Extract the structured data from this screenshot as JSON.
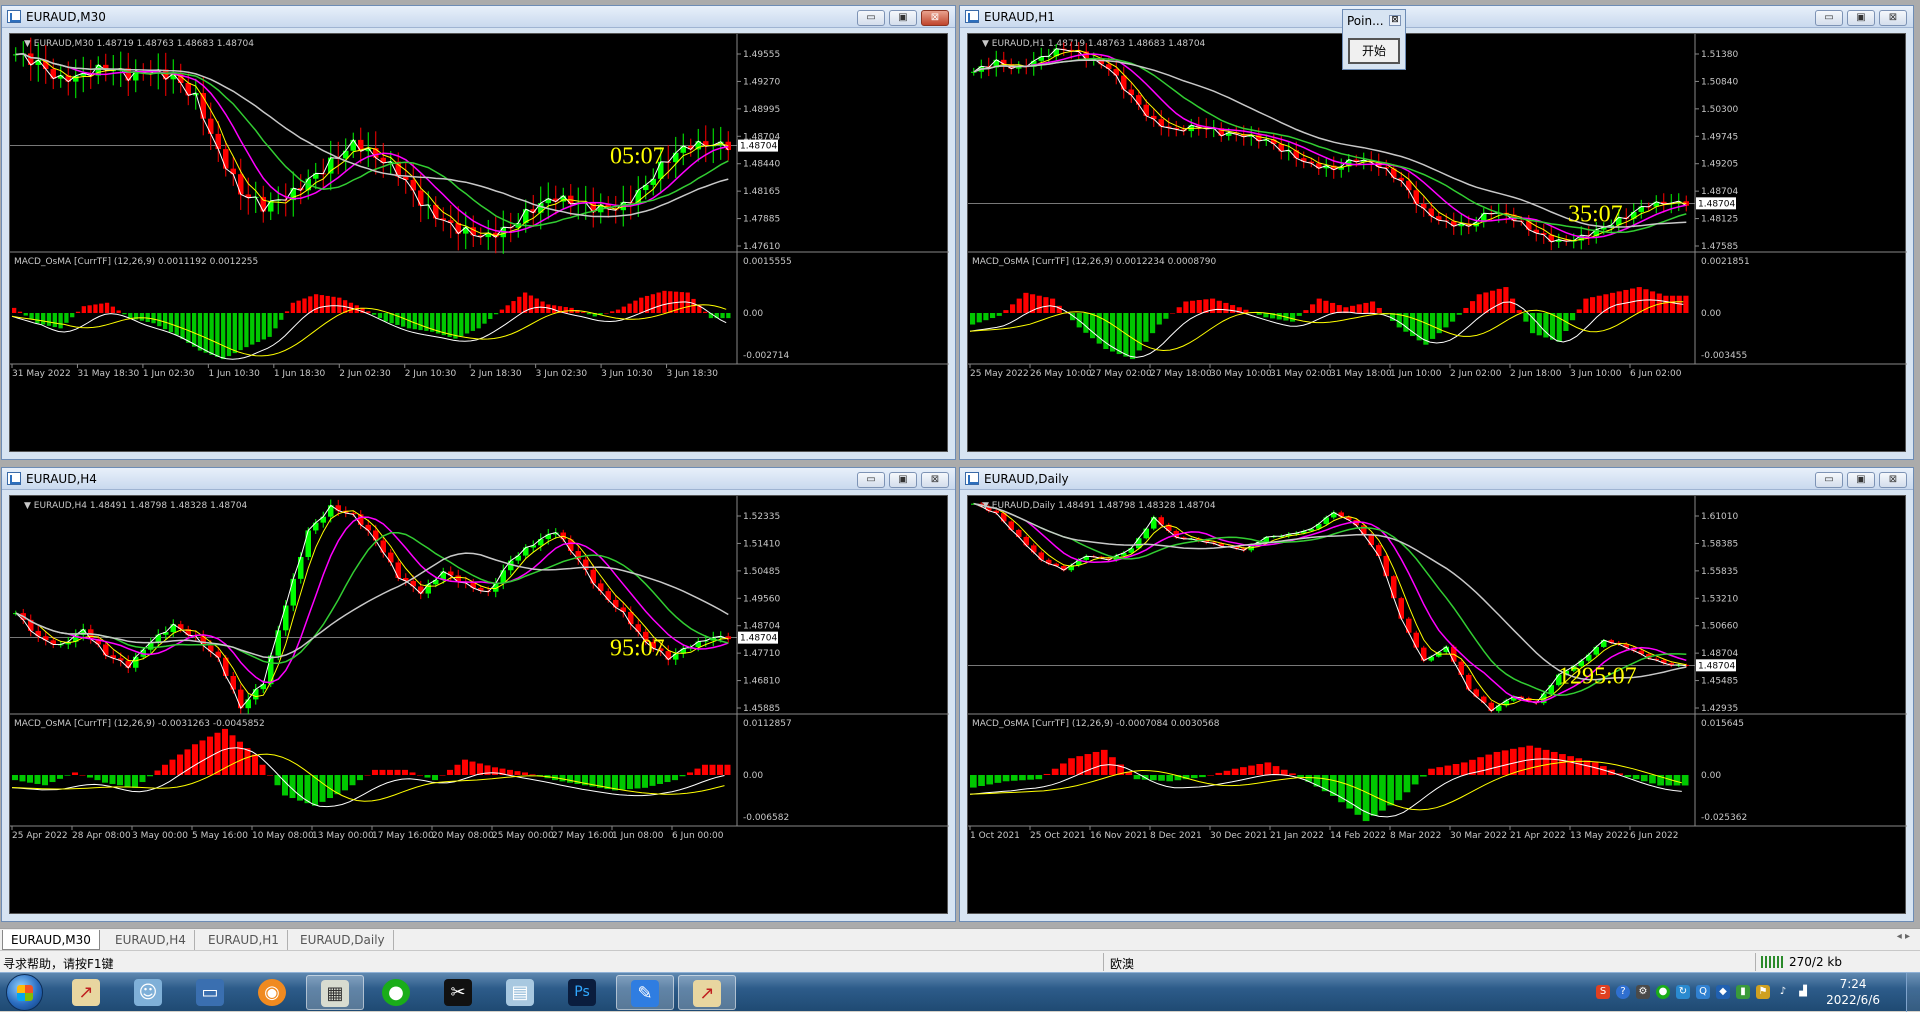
{
  "tabs": [
    "EURAUD,M30",
    "EURAUD,H4",
    "EURAUD,H1",
    "EURAUD,Daily"
  ],
  "tab_arrows": "◂ ▸",
  "status": {
    "help": "寻求帮助，请按F1键",
    "symbol": "欧澳",
    "traffic": "270/2 kb"
  },
  "point_window": {
    "title": "Poin...",
    "close": "⊠",
    "button": "开始"
  },
  "window_buttons": {
    "min": "▭",
    "max": "▣",
    "close": "⊠"
  },
  "taskbar": {
    "time": "7:24",
    "date": "2022/6/6",
    "apps": [
      "metatrader-icon",
      "user-accounts-icon",
      "desktop-icon",
      "browser-icon",
      "stock-app-icon",
      "wechat-icon",
      "capcut-icon",
      "notepad-icon",
      "photoshop-icon",
      "feishu-icon",
      "metatrader-icon"
    ]
  },
  "colors": {
    "price_line": "#c0c0c0",
    "candle_up": "#00ff00",
    "candle_down": "#ff0000",
    "ma_white": "#ffffff",
    "ma_yellow": "#ffff00",
    "ma_magenta": "#ff00ff",
    "ma_green": "#32cd32",
    "ma_gray": "#c8c8c8",
    "hist_pos": "#ff0000",
    "hist_neg": "#00c800",
    "timer": "#ffff00"
  },
  "charts": [
    {
      "title": "EURAUD,M30",
      "header": "EURAUD,M30  1.48719 1.48763 1.48683 1.48704",
      "macd_header": "MACD_OsMA [CurrTF] (12,26,9) 0.0011192 0.0012255",
      "timer": "05:07",
      "price_ticks": [
        "1.49555",
        "1.49270",
        "1.48995",
        "1.48704",
        "1.48440",
        "1.48165",
        "1.47885",
        "1.47610"
      ],
      "current_price": "1.48704",
      "macd_ticks": [
        "0.0015555",
        "0.00",
        "-0.002714"
      ],
      "time_labels": [
        "31 May 2022",
        "31 May 18:30",
        "1 Jun 02:30",
        "1 Jun 10:30",
        "1 Jun 18:30",
        "2 Jun 02:30",
        "2 Jun 10:30",
        "2 Jun 18:30",
        "3 Jun 02:30",
        "3 Jun 10:30",
        "3 Jun 18:30"
      ],
      "chart_data": {
        "type": "line",
        "series": [
          {
            "values": [
              1.4946,
              1.4938,
              1.4925,
              1.493,
              1.4936,
              1.4928,
              1.4931,
              1.4927,
              1.491,
              1.4866,
              1.4832,
              1.4819,
              1.4826,
              1.484,
              1.4856,
              1.4873,
              1.4862,
              1.4848,
              1.4822,
              1.4806,
              1.4798,
              1.4795,
              1.4803,
              1.4818,
              1.4826,
              1.4821,
              1.4817,
              1.482,
              1.4838,
              1.486,
              1.487,
              1.487
            ]
          }
        ]
      },
      "macd_data": [
        0.0003,
        -0.0006,
        -0.0009,
        0.0004,
        0.0006,
        -0.0003,
        -0.0006,
        -0.0013,
        -0.0022,
        -0.0027,
        -0.002,
        -0.0014,
        0.0006,
        0.0011,
        0.0009,
        0.0003,
        -0.0005,
        -0.0009,
        -0.0011,
        -0.0015,
        -0.0009,
        0.0002,
        0.0012,
        0.0005,
        0.0003,
        -0.0002,
        0.0002,
        0.0009,
        0.0013,
        0.0012,
        -0.0003
      ]
    },
    {
      "title": "EURAUD,H1",
      "header": "EURAUD,H1  1.48719 1.48763 1.48683 1.48704",
      "macd_header": "MACD_OsMA [CurrTF] (12,26,9) 0.0012234 0.0008790",
      "timer": "35:07",
      "price_ticks": [
        "1.51380",
        "1.50840",
        "1.50300",
        "1.49745",
        "1.49205",
        "1.48704",
        "1.48125",
        "1.47585"
      ],
      "current_price": "1.48704",
      "macd_ticks": [
        "0.0021851",
        "0.00",
        "-0.003455"
      ],
      "time_labels": [
        "25 May 2022",
        "26 May 10:00",
        "27 May 02:00",
        "27 May 18:00",
        "30 May 10:00",
        "31 May 02:00",
        "31 May 18:00",
        "1 Jun 10:00",
        "2 Jun 02:00",
        "2 Jun 18:00",
        "3 Jun 10:00",
        "6 Jun 02:00"
      ],
      "chart_data": {
        "type": "line",
        "series": [
          {
            "values": [
              1.5075,
              1.509,
              1.508,
              1.5098,
              1.5112,
              1.5098,
              1.508,
              1.5036,
              1.4998,
              1.4985,
              1.4992,
              1.498,
              1.4976,
              1.4968,
              1.495,
              1.4932,
              1.4926,
              1.494,
              1.493,
              1.4905,
              1.486,
              1.4842,
              1.4838,
              1.486,
              1.4848,
              1.4825,
              1.4812,
              1.482,
              1.4836,
              1.4852,
              1.487,
              1.4872
            ]
          }
        ]
      },
      "macd_data": [
        -0.0008,
        -0.0002,
        0.0014,
        0.001,
        -0.001,
        -0.0025,
        -0.0032,
        -0.0008,
        0.0008,
        0.001,
        0.0004,
        -0.0003,
        -0.0006,
        0.001,
        0.0004,
        0.0008,
        -0.001,
        -0.0022,
        -0.0006,
        0.0013,
        0.0018,
        -0.0014,
        -0.002,
        0.001,
        0.0014,
        0.0018,
        0.0012
      ]
    },
    {
      "title": "EURAUD,H4",
      "header": "EURAUD,H4  1.48491 1.48798 1.48328 1.48704",
      "macd_header": "MACD_OsMA [CurrTF] (12,26,9) -0.0031263 -0.0045852",
      "timer": "95:07",
      "price_ticks": [
        "1.52335",
        "1.51410",
        "1.50485",
        "1.49560",
        "1.48704",
        "1.47710",
        "1.46810",
        "1.45885"
      ],
      "current_price": "1.48704",
      "macd_ticks": [
        "0.0112857",
        "0.00",
        "-0.006582"
      ],
      "time_labels": [
        "25 Apr 2022",
        "28 Apr 08:00",
        "3 May 00:00",
        "5 May 16:00",
        "10 May 08:00",
        "13 May 00:00",
        "17 May 16:00",
        "20 May 08:00",
        "25 May 00:00",
        "27 May 16:00",
        "1 Jun 08:00",
        "6 Jun 00:00"
      ],
      "chart_data": {
        "type": "line",
        "series": [
          {
            "values": [
              1.493,
              1.487,
              1.485,
              1.489,
              1.483,
              1.48,
              1.486,
              1.49,
              1.487,
              1.482,
              1.47,
              1.476,
              1.495,
              1.513,
              1.519,
              1.517,
              1.511,
              1.502,
              1.498,
              1.503,
              1.5,
              1.498,
              1.506,
              1.51,
              1.513,
              1.506,
              1.498,
              1.493,
              1.486,
              1.482,
              1.485,
              1.487
            ]
          }
        ]
      },
      "macd_data": [
        -0.001,
        -0.002,
        0.0005,
        -0.0015,
        -0.0025,
        0.002,
        0.006,
        0.009,
        0.004,
        -0.004,
        -0.006,
        -0.003,
        0.001,
        0.001,
        -0.001,
        0.003,
        0.0015,
        0.0005,
        -0.001,
        -0.002,
        -0.003,
        -0.0025,
        -0.001,
        0.002
      ]
    },
    {
      "title": "EURAUD,Daily",
      "header": "EURAUD,Daily  1.48491 1.48798 1.48328 1.48704",
      "macd_header": "MACD_OsMA [CurrTF] (12,26,9) -0.0007084 0.0030568",
      "timer": "1295:07",
      "price_ticks": [
        "1.61010",
        "1.58385",
        "1.55835",
        "1.53210",
        "1.50660",
        "1.48704",
        "1.45485",
        "1.42935"
      ],
      "current_price": "1.48704",
      "macd_ticks": [
        "0.015645",
        "0.00",
        "-0.025362"
      ],
      "time_labels": [
        "1 Oct 2021",
        "25 Oct 2021",
        "16 Nov 2021",
        "8 Dec 2021",
        "30 Dec 2021",
        "21 Jan 2022",
        "14 Feb 2022",
        "8 Mar 2022",
        "30 Mar 2022",
        "21 Apr 2022",
        "13 May 2022",
        "6 Jun 2022"
      ],
      "chart_data": {
        "type": "line",
        "series": [
          {
            "values": [
              1.602,
              1.595,
              1.578,
              1.562,
              1.555,
              1.565,
              1.562,
              1.57,
              1.592,
              1.578,
              1.576,
              1.572,
              1.569,
              1.578,
              1.58,
              1.584,
              1.596,
              1.587,
              1.565,
              1.52,
              1.49,
              1.5,
              1.47,
              1.455,
              1.465,
              1.46,
              1.48,
              1.49,
              1.505,
              1.5,
              1.492,
              1.487
            ]
          }
        ]
      },
      "macd_data": [
        -0.006,
        -0.003,
        -0.002,
        0.008,
        0.012,
        -0.002,
        -0.003,
        -0.001,
        0.003,
        0.006,
        -0.001,
        -0.01,
        -0.022,
        -0.012,
        0.003,
        0.006,
        0.011,
        0.014,
        0.01,
        0.006,
        -0.001,
        -0.005
      ]
    }
  ]
}
